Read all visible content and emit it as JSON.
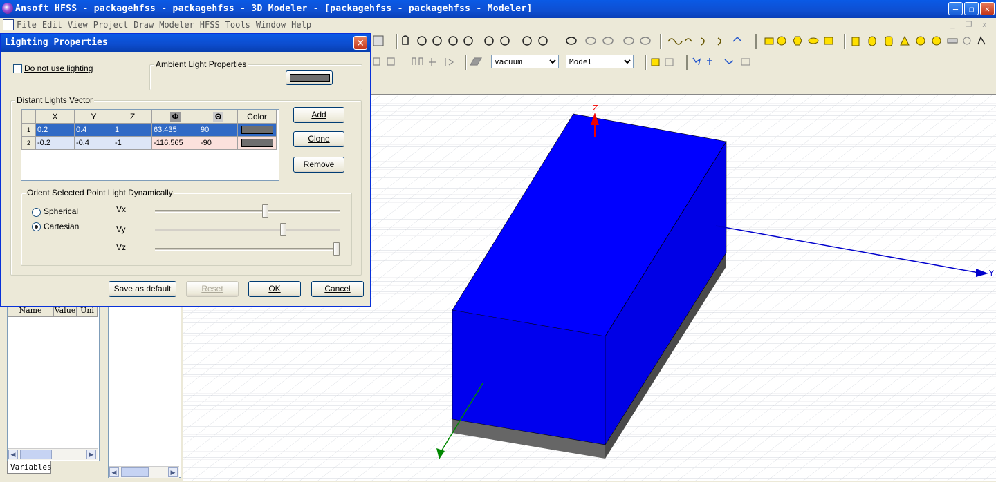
{
  "window": {
    "title": "Ansoft HFSS - packagehfss - packagehfss - 3D Modeler - [packagehfss - packagehfss - Modeler]"
  },
  "menu": {
    "items": [
      "File",
      "Edit",
      "View",
      "Project",
      "Draw",
      "Modeler",
      "HFSS",
      "Tools",
      "Window",
      "Help"
    ]
  },
  "toolbar": {
    "material_select": "vacuum",
    "model_select": "Model"
  },
  "dialog": {
    "title": "Lighting Properties",
    "no_lighting_label": "Do not use lighting",
    "no_lighting_checked": false,
    "ambient_group": "Ambient Light Properties",
    "ambient_color": "#6e6e6e",
    "distant_group": "Distant Lights Vector",
    "columns": [
      "X",
      "Y",
      "Z",
      "Φ",
      "Θ",
      "Color"
    ],
    "rows": [
      {
        "idx": "1",
        "x": "0.2",
        "y": "0.4",
        "z": "1",
        "phi": "63.435",
        "theta": "90",
        "color": "#6e6e6e"
      },
      {
        "idx": "2",
        "x": "-0.2",
        "y": "-0.4",
        "z": "-1",
        "phi": "-116.565",
        "theta": "-90",
        "color": "#6e6e6e"
      }
    ],
    "add_label": "Add",
    "clone_label": "Clone",
    "remove_label": "Remove",
    "orient_group": "Orient Selected Point Light Dynamically",
    "spherical_label": "Spherical",
    "cartesian_label": "Cartesian",
    "selected_mode": "Cartesian",
    "vx_label": "Vx",
    "vy_label": "Vy",
    "vz_label": "Vz",
    "vx_value": 0.6,
    "vy_value": 0.7,
    "vz_value": 1.0,
    "save_default_label": "Save as default",
    "reset_label": "Reset",
    "ok_label": "OK",
    "cancel_label": "Cancel"
  },
  "variables_panel": {
    "columns": [
      "Name",
      "Value",
      "Uni"
    ],
    "tab_label": "Variables"
  },
  "viewport": {
    "axis_z": "Z",
    "axis_y": "Y",
    "box_top_color": "#0000ff",
    "substrate_color": "#666666"
  }
}
